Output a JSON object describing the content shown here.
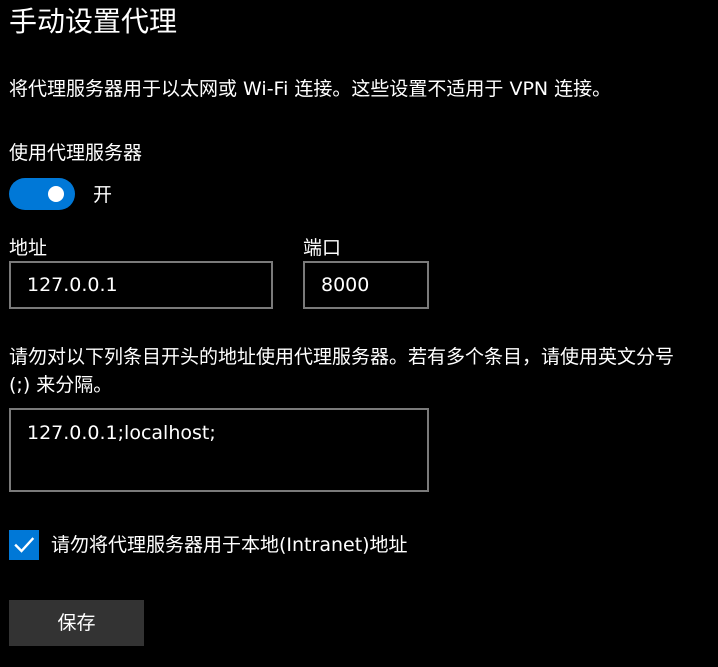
{
  "page": {
    "title": "手动设置代理",
    "description": "将代理服务器用于以太网或 Wi-Fi 连接。这些设置不适用于 VPN 连接。"
  },
  "proxy_toggle": {
    "label": "使用代理服务器",
    "state_text": "开",
    "on": true,
    "accent_color": "#0078d7"
  },
  "address": {
    "label": "地址",
    "value": "127.0.0.1"
  },
  "port": {
    "label": "端口",
    "value": "8000"
  },
  "exceptions": {
    "description": "请勿对以下列条目开头的地址使用代理服务器。若有多个条目，请使用英文分号 (;) 来分隔。",
    "value": "127.0.0.1;localhost;"
  },
  "bypass_local": {
    "label": "请勿将代理服务器用于本地(Intranet)地址",
    "checked": true,
    "icon": "checkmark-icon"
  },
  "actions": {
    "save_label": "保存"
  }
}
